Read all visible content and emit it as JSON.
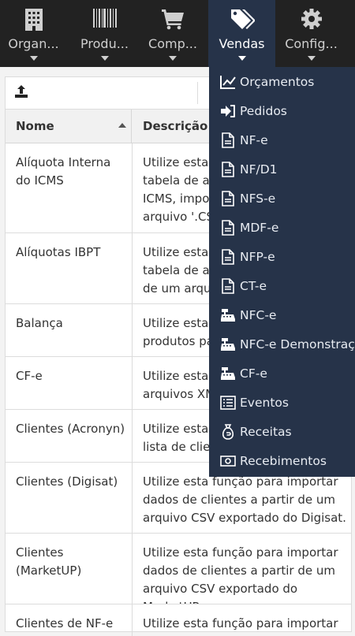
{
  "nav": {
    "items": [
      {
        "label": "Organ...",
        "icon": "building-icon"
      },
      {
        "label": "Produ...",
        "icon": "barcode-icon"
      },
      {
        "label": "Comp...",
        "icon": "cart-icon"
      },
      {
        "label": "Vendas",
        "icon": "tags-icon",
        "active": true
      },
      {
        "label": "Config...",
        "icon": "gear-icon"
      }
    ]
  },
  "toolbar": {
    "upload_icon": "upload-icon"
  },
  "table": {
    "headers": {
      "name": "Nome",
      "description": "Descrição"
    },
    "rows": [
      {
        "name": "Alíquota Interna do ICMS",
        "description": "Utilize esta função para importar a tabela de alíquotas internas de ICMS, importando a partir de um arquivo '.CSV'."
      },
      {
        "name": "Alíquotas IBPT",
        "description": "Utilize esta função para importar a tabela de alíquotas IBPT, a partir de um arquivo '.CSV'."
      },
      {
        "name": "Balança",
        "description": "Utilize esta função para exportar produtos para balança."
      },
      {
        "name": "CF-e",
        "description": "Utilize esta função para importar arquivos XML de CF-e."
      },
      {
        "name": "Clientes (Acronyn)",
        "description": "Utilize esta função para importar a lista de clientes do Acronyn."
      },
      {
        "name": "Clientes (Digisat)",
        "description": "Utilize esta função para importar dados de clientes a partir de um arquivo CSV exportado do Digisat."
      },
      {
        "name": "Clientes (MarketUP)",
        "description": "Utilize esta função para importar dados de clientes a partir de um arquivo CSV exportado do MarketUP."
      },
      {
        "name": "Clientes de NF-e",
        "description": "Utilize esta função para importar dados"
      }
    ]
  },
  "dropdown": {
    "items": [
      {
        "label": "Orçamentos",
        "icon": "line-chart-icon"
      },
      {
        "label": "Pedidos",
        "icon": "sign-in-icon"
      },
      {
        "label": "NF-e",
        "icon": "document-icon"
      },
      {
        "label": "NF/D1",
        "icon": "document-icon"
      },
      {
        "label": "NFS-e",
        "icon": "document-icon"
      },
      {
        "label": "MDF-e",
        "icon": "document-icon"
      },
      {
        "label": "NFP-e",
        "icon": "document-icon"
      },
      {
        "label": "CT-e",
        "icon": "document-icon"
      },
      {
        "label": "NFC-e",
        "icon": "cash-register-icon"
      },
      {
        "label": "NFC-e Demonstração",
        "icon": "cash-register-icon"
      },
      {
        "label": "CF-e",
        "icon": "cash-register-icon"
      },
      {
        "label": "Eventos",
        "icon": "list-icon"
      },
      {
        "label": "Receitas",
        "icon": "money-bag-icon"
      },
      {
        "label": "Recebimentos",
        "icon": "money-bill-icon"
      }
    ]
  }
}
